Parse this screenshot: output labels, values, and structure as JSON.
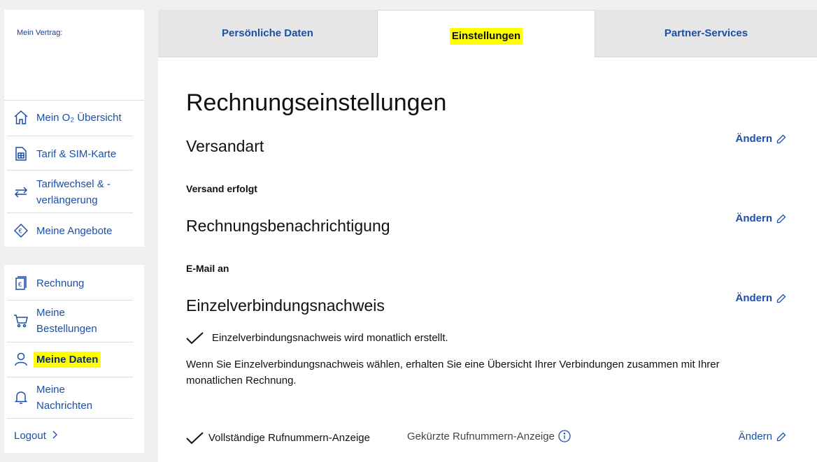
{
  "sidebar": {
    "vertrag_label": "Mein Vertrag:",
    "items": [
      {
        "label": "Mein O₂ Übersicht",
        "icon": "home-icon"
      },
      {
        "label": "Tarif & SIM-Karte",
        "icon": "sim-card-icon"
      },
      {
        "label": "Tarifwechsel & -verlängerung",
        "icon": "swap-arrows-icon"
      },
      {
        "label": "Meine Angebote",
        "icon": "offer-tag-icon"
      }
    ],
    "items2": [
      {
        "label": "Rechnung",
        "icon": "invoice-icon"
      },
      {
        "label": "Meine Bestellungen",
        "icon": "cart-icon"
      },
      {
        "label": "Meine Daten",
        "icon": "user-icon"
      },
      {
        "label": "Meine Nachrichten",
        "icon": "bell-icon"
      }
    ],
    "logout": "Logout"
  },
  "tabs": [
    {
      "label": "Persönliche Daten"
    },
    {
      "label": "Einstellungen"
    },
    {
      "label": "Partner-Services"
    }
  ],
  "main": {
    "title": "Rechnungseinstellungen",
    "change_label": "Ändern",
    "versandart": {
      "heading": "Versandart",
      "label": "Versand erfolgt"
    },
    "benachrichtigung": {
      "heading": "Rechnungsbenachrichtigung",
      "label": "E-Mail an"
    },
    "evn": {
      "heading": "Einzelverbindungsnachweis",
      "check_text": "Einzelverbindungsnachweis wird monatlich erstellt.",
      "description": "Wenn Sie Einzelverbindungsnachweis wählen, erhalten Sie eine Übersicht Ihrer Verbindungen zusammen mit Ihrer monatlichen Rechnung."
    },
    "rufnummer": {
      "selected": "Vollständige Rufnummern-Anzeige",
      "other": "Gekürzte Rufnummern-Anzeige"
    }
  },
  "colors": {
    "accent": "#1c4fa8",
    "highlight": "#ffff00",
    "background": "#f0f0f2"
  }
}
